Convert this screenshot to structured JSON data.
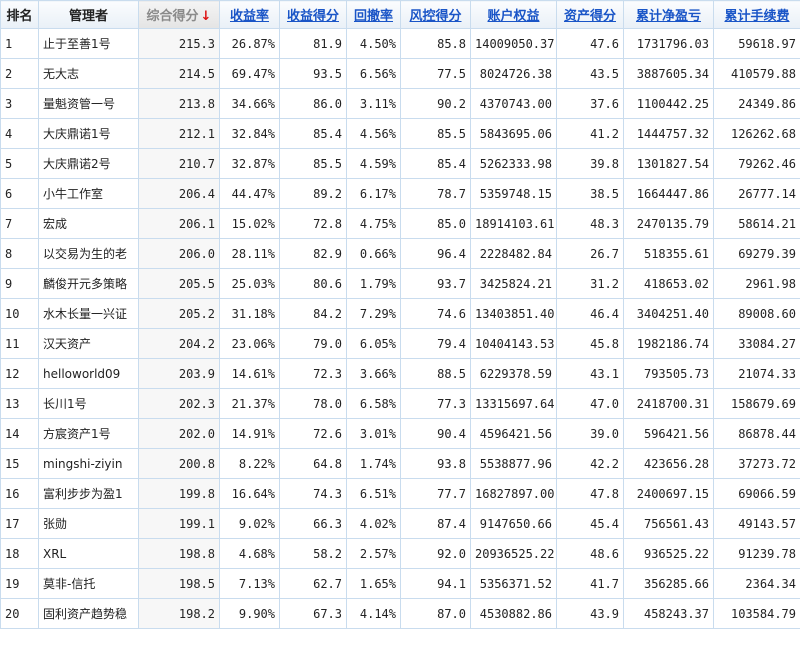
{
  "columns": [
    {
      "key": "rank",
      "label": "排名",
      "style": "plain"
    },
    {
      "key": "manager",
      "label": "管理者",
      "style": "plain"
    },
    {
      "key": "score",
      "label": "综合得分",
      "style": "sorted"
    },
    {
      "key": "return_rate",
      "label": "收益率",
      "style": "link"
    },
    {
      "key": "return_score",
      "label": "收益得分",
      "style": "link"
    },
    {
      "key": "drawdown",
      "label": "回撤率",
      "style": "link"
    },
    {
      "key": "risk_score",
      "label": "风控得分",
      "style": "link"
    },
    {
      "key": "equity",
      "label": "账户权益",
      "style": "link"
    },
    {
      "key": "asset_score",
      "label": "资产得分",
      "style": "link"
    },
    {
      "key": "net_pnl",
      "label": "累计净盈亏",
      "style": "link"
    },
    {
      "key": "fees",
      "label": "累计手续费",
      "style": "link"
    }
  ],
  "sort_icon": "↓",
  "colors": {
    "link": "#1a55c7",
    "negative": "#cc1111",
    "border": "#c9dcee",
    "sort_arrow": "#dd1111"
  },
  "rows": [
    {
      "rank": "1",
      "manager": "止于至善1号",
      "score": "215.3",
      "return_rate": "26.87%",
      "return_score": "81.9",
      "drawdown": "4.50%",
      "risk_score": "85.8",
      "equity": "14009050.37",
      "asset_score": "47.6",
      "net_pnl": "1731796.03",
      "fees": "59618.97"
    },
    {
      "rank": "2",
      "manager": "无大志",
      "score": "214.5",
      "return_rate": "69.47%",
      "return_score": "93.5",
      "drawdown": "6.56%",
      "risk_score": "77.5",
      "equity": "8024726.38",
      "asset_score": "43.5",
      "net_pnl": "3887605.34",
      "fees": "410579.88"
    },
    {
      "rank": "3",
      "manager": "量魁资管一号",
      "score": "213.8",
      "return_rate": "34.66%",
      "return_score": "86.0",
      "drawdown": "3.11%",
      "risk_score": "90.2",
      "equity": "4370743.00",
      "asset_score": "37.6",
      "net_pnl": "1100442.25",
      "fees": "24349.86"
    },
    {
      "rank": "4",
      "manager": "大庆鼎诺1号",
      "score": "212.1",
      "return_rate": "32.84%",
      "return_score": "85.4",
      "drawdown": "4.56%",
      "risk_score": "85.5",
      "equity": "5843695.06",
      "asset_score": "41.2",
      "net_pnl": "1444757.32",
      "fees": "126262.68"
    },
    {
      "rank": "5",
      "manager": "大庆鼎诺2号",
      "score": "210.7",
      "return_rate": "32.87%",
      "return_score": "85.5",
      "drawdown": "4.59%",
      "risk_score": "85.4",
      "equity": "5262333.98",
      "asset_score": "39.8",
      "net_pnl": "1301827.54",
      "fees": "79262.46"
    },
    {
      "rank": "6",
      "manager": "小牛工作室",
      "score": "206.4",
      "return_rate": "44.47%",
      "return_score": "89.2",
      "drawdown": "6.17%",
      "risk_score": "78.7",
      "equity": "5359748.15",
      "asset_score": "38.5",
      "net_pnl": "1664447.86",
      "fees": "26777.14"
    },
    {
      "rank": "7",
      "manager": "宏成",
      "score": "206.1",
      "return_rate": "15.02%",
      "return_score": "72.8",
      "drawdown": "4.75%",
      "risk_score": "85.0",
      "equity": "18914103.61",
      "asset_score": "48.3",
      "net_pnl": "2470135.79",
      "fees": "58614.21"
    },
    {
      "rank": "8",
      "manager": "以交易为生的老",
      "score": "206.0",
      "return_rate": "28.11%",
      "return_score": "82.9",
      "drawdown": "0.66%",
      "risk_score": "96.4",
      "equity": "2228482.84",
      "asset_score": "26.7",
      "net_pnl": "518355.61",
      "fees": "69279.39"
    },
    {
      "rank": "9",
      "manager": "麟俊开元多策略",
      "score": "205.5",
      "return_rate": "25.03%",
      "return_score": "80.6",
      "drawdown": "1.79%",
      "risk_score": "93.7",
      "equity": "3425824.21",
      "asset_score": "31.2",
      "net_pnl": "418653.02",
      "fees": "2961.98"
    },
    {
      "rank": "10",
      "manager": "水木长量一兴证",
      "score": "205.2",
      "return_rate": "31.18%",
      "return_score": "84.2",
      "drawdown": "7.29%",
      "risk_score": "74.6",
      "equity": "13403851.40",
      "asset_score": "46.4",
      "net_pnl": "3404251.40",
      "fees": "89008.60"
    },
    {
      "rank": "11",
      "manager": "汉天资产",
      "score": "204.2",
      "return_rate": "23.06%",
      "return_score": "79.0",
      "drawdown": "6.05%",
      "risk_score": "79.4",
      "equity": "10404143.53",
      "asset_score": "45.8",
      "net_pnl": "1982186.74",
      "fees": "33084.27"
    },
    {
      "rank": "12",
      "manager": "helloworld09",
      "score": "203.9",
      "return_rate": "14.61%",
      "return_score": "72.3",
      "drawdown": "3.66%",
      "risk_score": "88.5",
      "equity": "6229378.59",
      "asset_score": "43.1",
      "net_pnl": "793505.73",
      "fees": "21074.33"
    },
    {
      "rank": "13",
      "manager": "长川1号",
      "score": "202.3",
      "return_rate": "21.37%",
      "return_score": "78.0",
      "drawdown": "6.58%",
      "risk_score": "77.3",
      "equity": "13315697.64",
      "asset_score": "47.0",
      "net_pnl": "2418700.31",
      "fees": "158679.69"
    },
    {
      "rank": "14",
      "manager": "方宸资产1号",
      "score": "202.0",
      "return_rate": "14.91%",
      "return_score": "72.6",
      "drawdown": "3.01%",
      "risk_score": "90.4",
      "equity": "4596421.56",
      "asset_score": "39.0",
      "net_pnl": "596421.56",
      "fees": "86878.44"
    },
    {
      "rank": "15",
      "manager": "mingshi-ziyin",
      "score": "200.8",
      "return_rate": "8.22%",
      "return_score": "64.8",
      "drawdown": "1.74%",
      "risk_score": "93.8",
      "equity": "5538877.96",
      "asset_score": "42.2",
      "net_pnl": "423656.28",
      "fees": "37273.72"
    },
    {
      "rank": "16",
      "manager": "富利步步为盈1",
      "score": "199.8",
      "return_rate": "16.64%",
      "return_score": "74.3",
      "drawdown": "6.51%",
      "risk_score": "77.7",
      "equity": "16827897.00",
      "asset_score": "47.8",
      "net_pnl": "2400697.15",
      "fees": "69066.59"
    },
    {
      "rank": "17",
      "manager": "张勋",
      "score": "199.1",
      "return_rate": "9.02%",
      "return_score": "66.3",
      "drawdown": "4.02%",
      "risk_score": "87.4",
      "equity": "9147650.66",
      "asset_score": "45.4",
      "net_pnl": "756561.43",
      "fees": "49143.57"
    },
    {
      "rank": "18",
      "manager": "XRL",
      "score": "198.8",
      "return_rate": "4.68%",
      "return_score": "58.2",
      "drawdown": "2.57%",
      "risk_score": "92.0",
      "equity": "20936525.22",
      "asset_score": "48.6",
      "net_pnl": "936525.22",
      "fees": "91239.78"
    },
    {
      "rank": "19",
      "manager": "莫非-信托",
      "score": "198.5",
      "return_rate": "7.13%",
      "return_score": "62.7",
      "drawdown": "1.65%",
      "risk_score": "94.1",
      "equity": "5356371.52",
      "asset_score": "41.7",
      "net_pnl": "356285.66",
      "fees": "2364.34"
    },
    {
      "rank": "20",
      "manager": "固利资产趋势稳",
      "score": "198.2",
      "return_rate": "9.90%",
      "return_score": "67.3",
      "drawdown": "4.14%",
      "risk_score": "87.0",
      "equity": "4530882.86",
      "asset_score": "43.9",
      "net_pnl": "458243.37",
      "fees": "103584.79"
    }
  ]
}
